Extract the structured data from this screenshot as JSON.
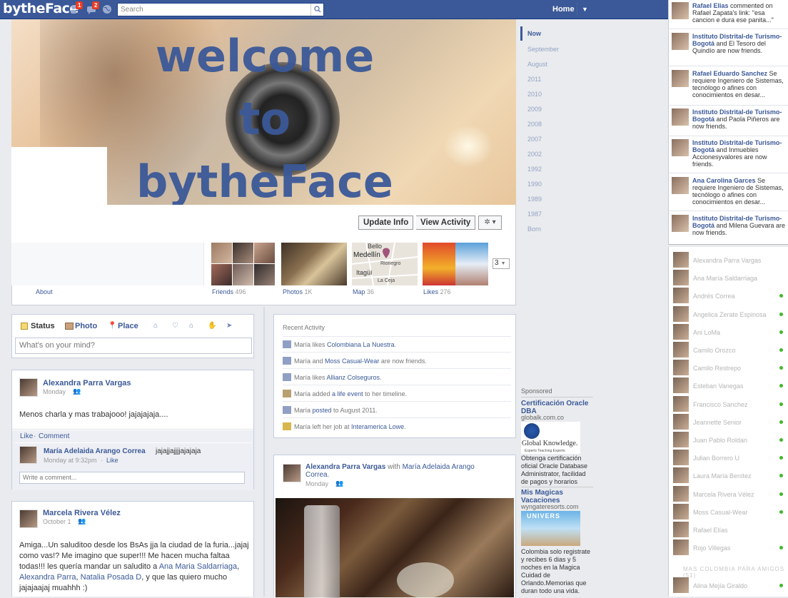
{
  "topbar": {
    "logo": "bytheFace",
    "friend_requests_count": "1",
    "messages_count": "2",
    "search_placeholder": "Search",
    "home_label": "Home"
  },
  "cover": {
    "lines": [
      "welcome",
      "to",
      "bytheFace"
    ]
  },
  "profile_actions": {
    "update_info": "Update Info",
    "view_activity": "View Activity",
    "settings_glyph": "✲ ▾"
  },
  "apps": {
    "about": "About",
    "friends": {
      "label": "Friends",
      "count": "496"
    },
    "photos": {
      "label": "Photos",
      "count": "1K"
    },
    "map": {
      "label": "Map",
      "count": "36",
      "places": [
        "Bello",
        "Medellín",
        "Rionegro",
        "Itagüí",
        "La Ceja"
      ]
    },
    "likes": {
      "label": "Likes",
      "count": "276"
    },
    "more": "3"
  },
  "composer": {
    "status": "Status",
    "photo": "Photo",
    "place": "Place",
    "placeholder": "What's on your mind?"
  },
  "post1": {
    "author": "Alexandra Parra Vargas",
    "time": "Monday",
    "text": "Menos charla y mas trabajooo! jajajajaja....",
    "like": "Like",
    "dot": "·",
    "comment": "Comment",
    "comment_author": "María Adelaida Arango Correa",
    "comment_text": "jajajjajjjjajajaja",
    "comment_time": "Monday at 9:32pm",
    "comment_like": "Like",
    "write_placeholder": "Write a comment..."
  },
  "post2": {
    "author": "Marcela Rivera Vélez",
    "time": "October 1",
    "text_a": "Amiga...Un saluditoo desde los BsAs jja la ciudad de la furia...jajaj como vas!? Me imagino que super!!! Me hacen mucha faltaa todas!!! les quería mandar un saludito a ",
    "link1": "Ana Maria Saldarriaga",
    "sep1": ", ",
    "link2": "Alexandra Parra",
    "sep2": ", ",
    "link3": "Natalia Posada D",
    "text_b": ", y que las quiero mucho jajajaajaj muahhh :)"
  },
  "recent": {
    "title": "Recent Activity",
    "items": [
      {
        "pre": "María likes ",
        "link": "Colombiana La Nuestra",
        "post": "."
      },
      {
        "pre": "María and ",
        "link": "Moss Casual-Wear",
        "post": " are now friends."
      },
      {
        "pre": "María likes ",
        "link": "Allianz Colseguros",
        "post": "."
      },
      {
        "pre": "María added ",
        "link": "a life event",
        "post": " to her timeline."
      },
      {
        "pre": "María ",
        "link": "posted",
        "post": " to August 2011."
      },
      {
        "pre": "María left her job at ",
        "link": "Interamerica Lowe",
        "post": "."
      }
    ]
  },
  "post3": {
    "author": "Alexandra Parra Vargas",
    "with": " with ",
    "tagged": "María Adelaida Arango Correa",
    "end": ".",
    "time": "Monday"
  },
  "timeline_nav": {
    "now": "Now",
    "items": [
      "September",
      "August",
      "2011",
      "2010",
      "2009",
      "2008",
      "2007",
      "2002",
      "1992",
      "1990",
      "1989",
      "1987",
      "Born"
    ]
  },
  "ads": {
    "sponsored": "Sponsored",
    "ad1": {
      "title": "Certificación Oracle DBA",
      "url": "globalk.com.co",
      "logo": "Global Knowledge.",
      "logo_sub": "Experts Teaching Experts",
      "body": "Obtenga certificación oficial Oracle Database Administrator, facilidad de pagos y horarios"
    },
    "ad2": {
      "title": "Mis Magicas Vacaciones",
      "url": "wyngateresorts.com",
      "img_text": "UNIVERS",
      "body": "Colombia solo registrate y recibes 6 dias y 5 noches en la Magica Cuidad de Orlando.Memorias que duran todo una vida."
    }
  },
  "ticker": [
    {
      "name": "Rafael Elias",
      "text": " commented on Rafael Zapata's link: \"esa cancion e dura ese panita...\""
    },
    {
      "name": "Instituto Distrital-de Turismo-Bogotá",
      "text": " and El Tesoro del Quindío are now friends."
    },
    {
      "name": "Rafael Eduardo Sanchez",
      "text": " Se requiere Ingeniero de Sistemas, tecnólogo o afines con conocimientos en desar..."
    },
    {
      "name": "Instituto Distrital-de Turismo-Bogotá",
      "text": " and Paola Piñeros are now friends."
    },
    {
      "name": "Instituto Distrital-de Turismo-Bogotá",
      "text": " and Inmuebles Accionesyvalores are now friends."
    },
    {
      "name": "Ana Carolina Garces",
      "text": " Se requiere Ingeniero de Sistemas, tecnólogo o afines con conocimientos en desar..."
    },
    {
      "name": "Instituto Distrital-de Turismo-Bogotá",
      "text": " and Milena Guevara are now friends."
    }
  ],
  "chat": {
    "friends": [
      {
        "name": "Alexandra Parra Vargas",
        "online": false
      },
      {
        "name": "Ana María Saldarriaga",
        "online": false
      },
      {
        "name": "Andrés Correa",
        "online": true
      },
      {
        "name": "Angelica Zerate Espinosa",
        "online": true
      },
      {
        "name": "Ani LoMa",
        "online": true
      },
      {
        "name": "Camilo Orozco",
        "online": true
      },
      {
        "name": "Camilo Restrepo",
        "online": true
      },
      {
        "name": "Esteban Vanegas",
        "online": true
      },
      {
        "name": "Francisco Sanchez",
        "online": true
      },
      {
        "name": "Jeannette Senior",
        "online": true
      },
      {
        "name": "Juan Pablo Roldan",
        "online": true
      },
      {
        "name": "Julian Borrero U",
        "online": true
      },
      {
        "name": "Laura María Benítez",
        "online": true
      },
      {
        "name": "Marcela Rivera Vélez",
        "online": true
      },
      {
        "name": "Moss Casual-Wear",
        "online": true
      },
      {
        "name": "Rafael Elías",
        "online": false
      },
      {
        "name": "Rojo Villegas",
        "online": true
      }
    ],
    "section_label": "MAS COLOMBIA PARA AMIGOS (51)",
    "more": [
      {
        "name": "Alina Mejía Giraldo",
        "online": true
      }
    ]
  }
}
